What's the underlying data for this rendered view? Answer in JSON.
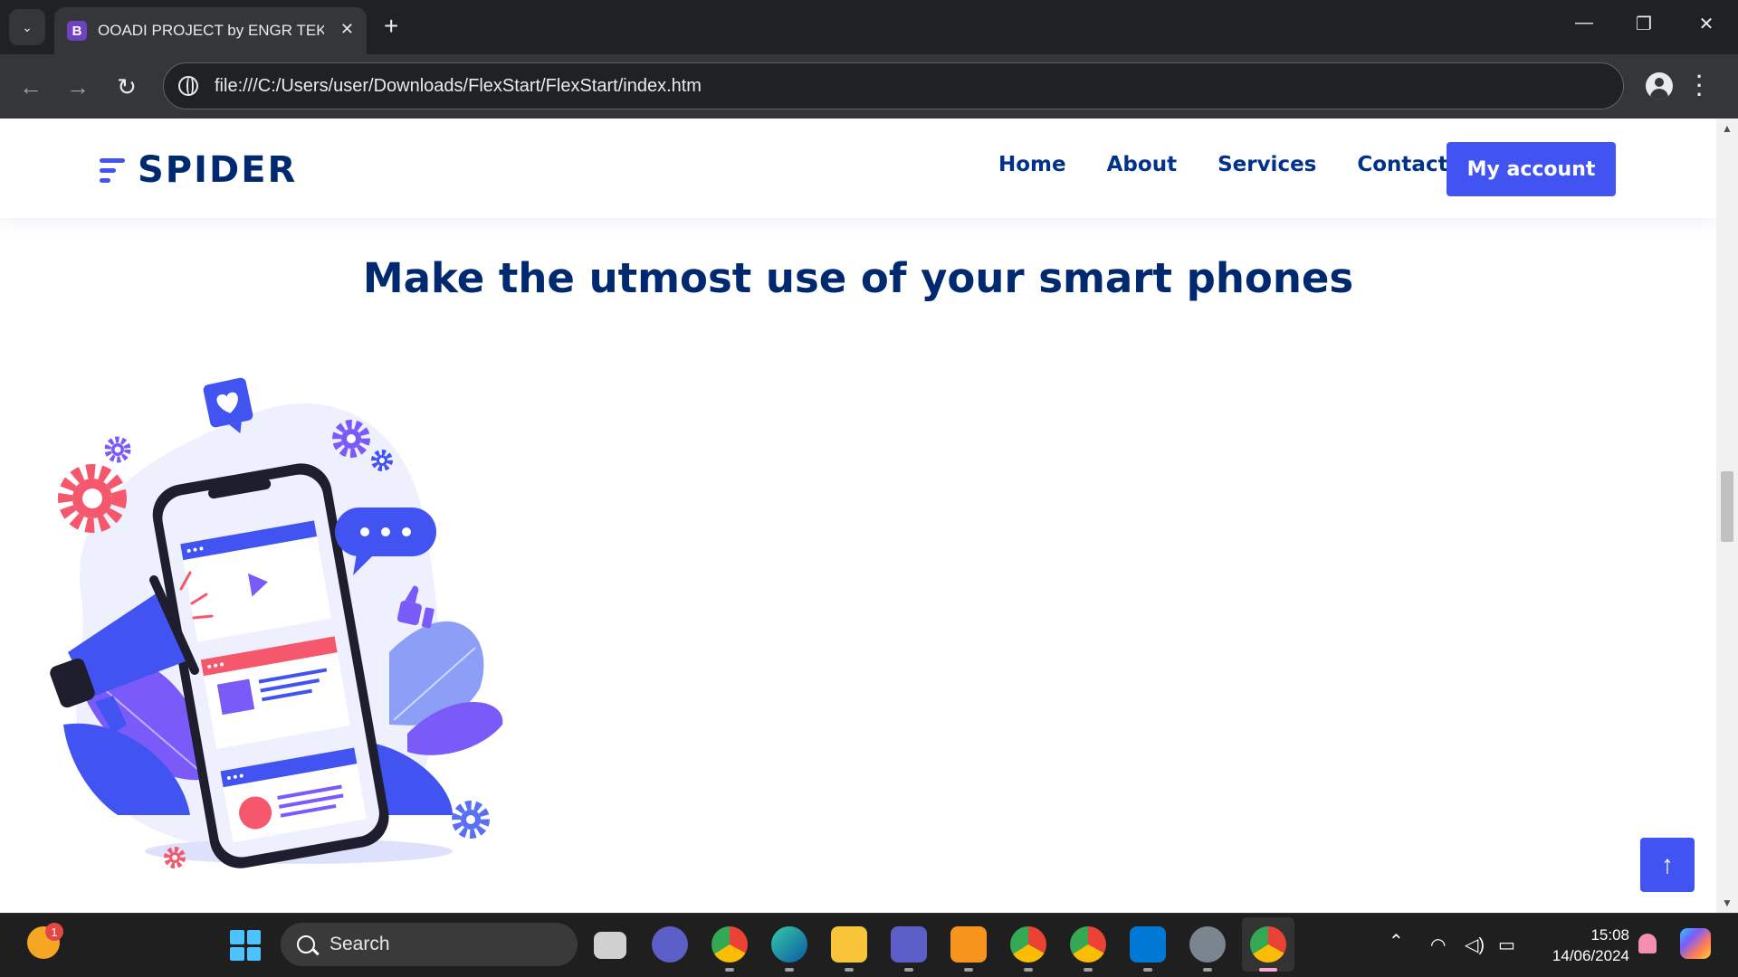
{
  "browser": {
    "tab_title": "OOADI PROJECT by ENGR TEKO",
    "tab_favicon_letter": "B",
    "url": "file:///C:/Users/user/Downloads/FlexStart/FlexStart/index.htm"
  },
  "site": {
    "logo_text": "SPIDER",
    "nav": [
      "Home",
      "About",
      "Services",
      "Contact"
    ],
    "account_button": "My account",
    "headline": "Make the utmost use of your smart phones",
    "colors": {
      "primary": "#4154f1",
      "navy": "#012970",
      "accent_pink": "#f5576c",
      "accent_purple": "#7a5af8"
    }
  },
  "taskbar": {
    "search_label": "Search",
    "time": "15:08",
    "date": "14/06/2024",
    "weather_badge": "1",
    "apps": [
      "file-explorer-icon",
      "teams-icon",
      "chrome-icon",
      "edge-icon",
      "folder-icon",
      "teams-work-icon",
      "pdf-icon",
      "chrome-icon",
      "chrome-icon",
      "vscode-icon",
      "settings-icon",
      "chrome-icon"
    ]
  }
}
